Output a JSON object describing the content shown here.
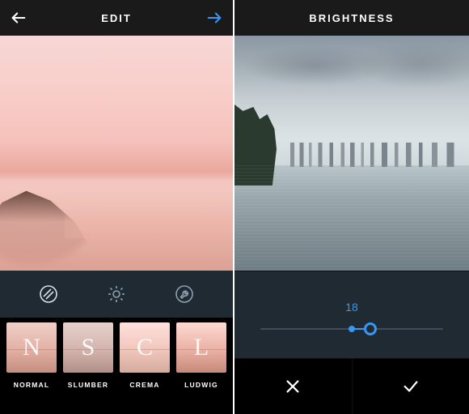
{
  "left": {
    "title": "EDIT",
    "tools": {
      "active": 0
    },
    "filters": [
      {
        "letter": "N",
        "label": "NORMAL"
      },
      {
        "letter": "S",
        "label": "SLUMBER"
      },
      {
        "letter": "C",
        "label": "CREMA"
      },
      {
        "letter": "L",
        "label": "LUDWIG"
      }
    ]
  },
  "right": {
    "title": "BRIGHTNESS",
    "slider": {
      "value": "18",
      "min": -100,
      "max": 100,
      "current": 18
    }
  },
  "colors": {
    "accent": "#3897f0",
    "panel": "#1f2a33"
  }
}
